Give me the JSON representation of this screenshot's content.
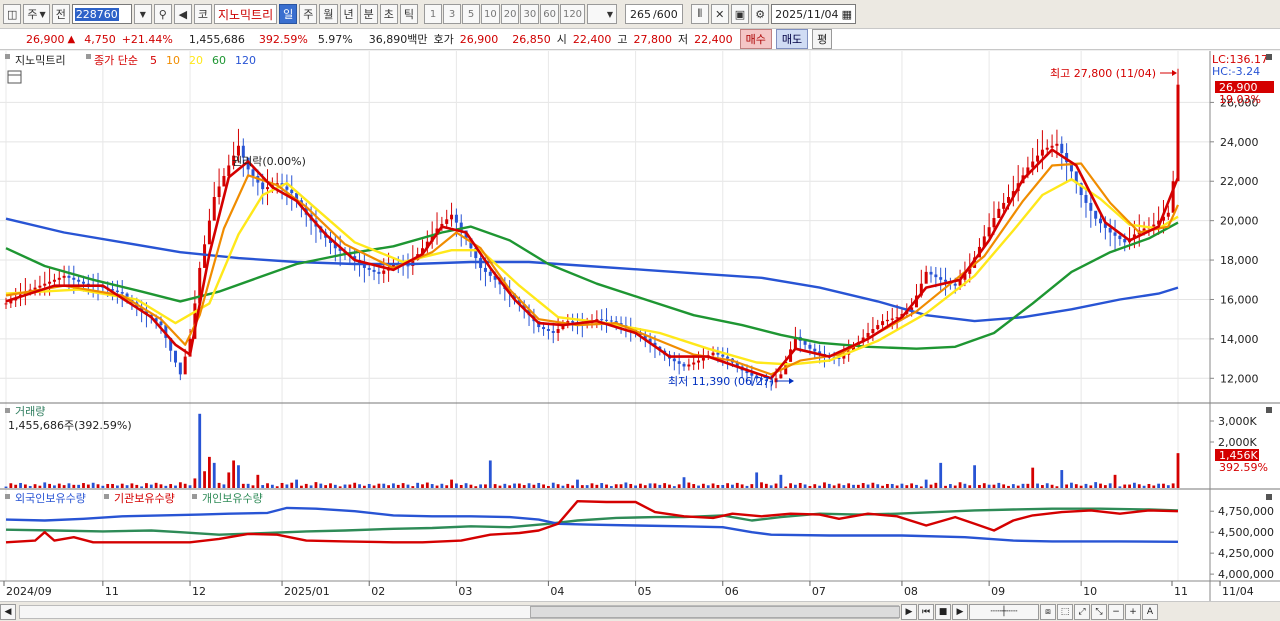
{
  "toolbar": {
    "market_btn": "주",
    "prev_btn": "전",
    "stock_code": "228760",
    "market_short": "코",
    "stock_name": "지노믹트리",
    "periods": [
      "일",
      "주",
      "월",
      "년",
      "분",
      "초",
      "틱"
    ],
    "active_period": "일",
    "intervals": [
      "1",
      "3",
      "5",
      "10",
      "20",
      "30",
      "60",
      "120"
    ],
    "count": "265",
    "count_total": "/600",
    "date": "2025/11/04"
  },
  "quote": {
    "price": "26,900",
    "change": "4,750",
    "change_pct": "+21.44%",
    "volume": "1,455,686",
    "volume_ratio": "392.59%",
    "turnover": "5.97%",
    "amount": "36,890백만",
    "ask_label": "호가",
    "ask1": "26,900",
    "ask2": "26,850",
    "open_label": "시",
    "open": "22,400",
    "high_label": "고",
    "high": "27,800",
    "low_label": "저",
    "low": "22,400",
    "buy_btn": "매수",
    "sell_btn": "매도",
    "eval_btn": "평"
  },
  "panels": {
    "price": {
      "legend_name": "지노믹트리",
      "legend_ma": "종가 단순",
      "ma_periods": [
        "5",
        "10",
        "20",
        "60",
        "120"
      ],
      "ma_colors": [
        "#d40000",
        "#f08c00",
        "#ffe81a",
        "#1e9632",
        "#2854d4"
      ],
      "lc": "LC:136.17",
      "hc": "HC:-3.24",
      "last_price_tag": "26,900",
      "last_pct_tag": "19.03%",
      "annotation_high": "최고 27,800 (11/04)",
      "annotation_low": "최저 11,390 (06/27)",
      "annotation_rights": "권리락(0.00%)",
      "y_ticks": [
        "26,000",
        "24,000",
        "22,000",
        "20,000",
        "18,000",
        "16,000",
        "14,000",
        "12,000"
      ]
    },
    "volume": {
      "title": "거래량",
      "current": "1,455,686주(392.59%)",
      "y_ticks": [
        "3,000K",
        "2,000K"
      ],
      "last_tag": "1,456K",
      "last_pct_tag": "392.59%"
    },
    "holdings": {
      "series_names": [
        "외국인보유수량",
        "기관보유수량",
        "개인보유수량"
      ],
      "colors": [
        "#2854d4",
        "#d40000",
        "#2e8b57"
      ],
      "y_ticks": [
        "4,750,000",
        "4,500,000",
        "4,250,000",
        "4,000,000"
      ]
    }
  },
  "x_axis": {
    "labels": [
      "2024/09",
      "11",
      "12",
      "2025/01",
      "02",
      "03",
      "04",
      "05",
      "06",
      "07",
      "08",
      "09",
      "10",
      "11",
      "11/04"
    ]
  },
  "chart_data": {
    "type": "line",
    "y_range": [
      11000,
      28000
    ],
    "close_series": [
      [
        0,
        15800
      ],
      [
        4,
        16400
      ],
      [
        8,
        16800
      ],
      [
        12,
        17200
      ],
      [
        16,
        16800
      ],
      [
        20,
        16600
      ],
      [
        24,
        16300
      ],
      [
        28,
        15400
      ],
      [
        32,
        14700
      ],
      [
        34,
        13400
      ],
      [
        36,
        12200
      ],
      [
        38,
        14000
      ],
      [
        40,
        17600
      ],
      [
        43,
        21200
      ],
      [
        46,
        22800
      ],
      [
        48,
        23800
      ],
      [
        50,
        22600
      ],
      [
        53,
        21600
      ],
      [
        56,
        21900
      ],
      [
        59,
        21400
      ],
      [
        62,
        20300
      ],
      [
        65,
        19400
      ],
      [
        68,
        18600
      ],
      [
        71,
        18200
      ],
      [
        74,
        17600
      ],
      [
        77,
        17300
      ],
      [
        80,
        17800
      ],
      [
        83,
        17700
      ],
      [
        86,
        18600
      ],
      [
        89,
        19600
      ],
      [
        92,
        20300
      ],
      [
        95,
        19100
      ],
      [
        98,
        17600
      ],
      [
        101,
        17000
      ],
      [
        104,
        16300
      ],
      [
        107,
        15500
      ],
      [
        110,
        14600
      ],
      [
        113,
        14300
      ],
      [
        116,
        14900
      ],
      [
        119,
        14700
      ],
      [
        122,
        15000
      ],
      [
        125,
        14900
      ],
      [
        128,
        14600
      ],
      [
        131,
        14200
      ],
      [
        134,
        13600
      ],
      [
        137,
        13000
      ],
      [
        140,
        12600
      ],
      [
        143,
        12900
      ],
      [
        146,
        13300
      ],
      [
        149,
        13000
      ],
      [
        152,
        12400
      ],
      [
        155,
        12000
      ],
      [
        158,
        11800
      ],
      [
        160,
        12200
      ],
      [
        163,
        14100
      ],
      [
        166,
        13500
      ],
      [
        169,
        13100
      ],
      [
        172,
        13000
      ],
      [
        175,
        13600
      ],
      [
        178,
        14300
      ],
      [
        181,
        14900
      ],
      [
        184,
        15100
      ],
      [
        187,
        15600
      ],
      [
        190,
        17400
      ],
      [
        193,
        17000
      ],
      [
        196,
        16700
      ],
      [
        199,
        17600
      ],
      [
        202,
        19200
      ],
      [
        205,
        20600
      ],
      [
        208,
        21500
      ],
      [
        211,
        22700
      ],
      [
        214,
        23600
      ],
      [
        217,
        23900
      ],
      [
        220,
        22500
      ],
      [
        222,
        21300
      ],
      [
        225,
        20100
      ],
      [
        228,
        19400
      ],
      [
        231,
        18900
      ],
      [
        234,
        19500
      ],
      [
        237,
        19800
      ],
      [
        240,
        20400
      ],
      [
        241,
        22000
      ],
      [
        242,
        26900
      ]
    ],
    "ma5": [
      [
        0,
        15900
      ],
      [
        10,
        16700
      ],
      [
        20,
        16700
      ],
      [
        30,
        15100
      ],
      [
        35,
        13700
      ],
      [
        38,
        13200
      ],
      [
        42,
        18300
      ],
      [
        46,
        22200
      ],
      [
        50,
        23000
      ],
      [
        55,
        21700
      ],
      [
        60,
        21000
      ],
      [
        66,
        19300
      ],
      [
        72,
        18000
      ],
      [
        80,
        17500
      ],
      [
        86,
        18300
      ],
      [
        90,
        19700
      ],
      [
        95,
        19400
      ],
      [
        100,
        17600
      ],
      [
        105,
        16000
      ],
      [
        110,
        14800
      ],
      [
        115,
        14700
      ],
      [
        122,
        14900
      ],
      [
        130,
        14300
      ],
      [
        137,
        13100
      ],
      [
        145,
        13100
      ],
      [
        152,
        12500
      ],
      [
        158,
        12000
      ],
      [
        163,
        13500
      ],
      [
        170,
        13100
      ],
      [
        178,
        14000
      ],
      [
        185,
        15100
      ],
      [
        190,
        16600
      ],
      [
        197,
        17000
      ],
      [
        203,
        19000
      ],
      [
        210,
        22100
      ],
      [
        216,
        23600
      ],
      [
        221,
        22800
      ],
      [
        227,
        19900
      ],
      [
        232,
        19000
      ],
      [
        238,
        19700
      ],
      [
        242,
        22200
      ]
    ],
    "ma10": [
      [
        0,
        16200
      ],
      [
        12,
        16700
      ],
      [
        24,
        16200
      ],
      [
        32,
        15000
      ],
      [
        37,
        13700
      ],
      [
        40,
        15200
      ],
      [
        45,
        19600
      ],
      [
        50,
        22300
      ],
      [
        56,
        21800
      ],
      [
        62,
        20700
      ],
      [
        70,
        18800
      ],
      [
        80,
        17600
      ],
      [
        88,
        18400
      ],
      [
        93,
        19400
      ],
      [
        98,
        18600
      ],
      [
        104,
        16500
      ],
      [
        110,
        15000
      ],
      [
        118,
        14700
      ],
      [
        126,
        14800
      ],
      [
        134,
        14000
      ],
      [
        142,
        13200
      ],
      [
        150,
        12900
      ],
      [
        158,
        12200
      ],
      [
        164,
        12900
      ],
      [
        172,
        13200
      ],
      [
        180,
        14300
      ],
      [
        188,
        15400
      ],
      [
        195,
        16800
      ],
      [
        202,
        18200
      ],
      [
        210,
        21000
      ],
      [
        216,
        22800
      ],
      [
        222,
        22900
      ],
      [
        228,
        20900
      ],
      [
        234,
        19400
      ],
      [
        240,
        19700
      ],
      [
        242,
        20800
      ]
    ],
    "ma20": [
      [
        0,
        16300
      ],
      [
        15,
        16500
      ],
      [
        27,
        16000
      ],
      [
        35,
        14800
      ],
      [
        42,
        15800
      ],
      [
        48,
        19300
      ],
      [
        53,
        21300
      ],
      [
        58,
        21900
      ],
      [
        65,
        20400
      ],
      [
        72,
        18900
      ],
      [
        82,
        17900
      ],
      [
        92,
        18500
      ],
      [
        98,
        18500
      ],
      [
        106,
        16700
      ],
      [
        114,
        15100
      ],
      [
        124,
        14800
      ],
      [
        135,
        14300
      ],
      [
        145,
        13500
      ],
      [
        155,
        12800
      ],
      [
        162,
        12700
      ],
      [
        170,
        12900
      ],
      [
        180,
        13900
      ],
      [
        190,
        15300
      ],
      [
        200,
        17200
      ],
      [
        208,
        19500
      ],
      [
        214,
        21300
      ],
      [
        220,
        22100
      ],
      [
        226,
        21100
      ],
      [
        232,
        19800
      ],
      [
        238,
        19600
      ],
      [
        242,
        20200
      ]
    ],
    "ma60": [
      [
        0,
        18600
      ],
      [
        8,
        17700
      ],
      [
        18,
        17000
      ],
      [
        28,
        16400
      ],
      [
        36,
        15900
      ],
      [
        44,
        16400
      ],
      [
        52,
        17100
      ],
      [
        60,
        17800
      ],
      [
        70,
        18300
      ],
      [
        80,
        18700
      ],
      [
        90,
        19400
      ],
      [
        96,
        19700
      ],
      [
        104,
        19000
      ],
      [
        112,
        17800
      ],
      [
        122,
        16800
      ],
      [
        132,
        16000
      ],
      [
        142,
        15200
      ],
      [
        152,
        14700
      ],
      [
        160,
        14200
      ],
      [
        168,
        13800
      ],
      [
        178,
        13600
      ],
      [
        188,
        13500
      ],
      [
        196,
        13600
      ],
      [
        204,
        14300
      ],
      [
        212,
        15800
      ],
      [
        220,
        17400
      ],
      [
        228,
        18400
      ],
      [
        236,
        19100
      ],
      [
        242,
        19900
      ]
    ],
    "ma120": [
      [
        0,
        20100
      ],
      [
        12,
        19400
      ],
      [
        24,
        18900
      ],
      [
        36,
        18400
      ],
      [
        48,
        18100
      ],
      [
        60,
        17900
      ],
      [
        72,
        17800
      ],
      [
        84,
        17800
      ],
      [
        96,
        17900
      ],
      [
        108,
        17900
      ],
      [
        120,
        17700
      ],
      [
        132,
        17500
      ],
      [
        144,
        17300
      ],
      [
        156,
        17100
      ],
      [
        168,
        16600
      ],
      [
        180,
        15900
      ],
      [
        190,
        15200
      ],
      [
        200,
        14900
      ],
      [
        210,
        15100
      ],
      [
        220,
        15500
      ],
      [
        230,
        16000
      ],
      [
        238,
        16300
      ],
      [
        242,
        16600
      ]
    ],
    "volume_highlights": [
      [
        39,
        400
      ],
      [
        40,
        3100
      ],
      [
        41,
        700
      ],
      [
        42,
        1300
      ],
      [
        43,
        1050
      ],
      [
        46,
        650
      ],
      [
        47,
        1150
      ],
      [
        48,
        950
      ],
      [
        52,
        550
      ],
      [
        60,
        350
      ],
      [
        92,
        350
      ],
      [
        100,
        1150
      ],
      [
        118,
        350
      ],
      [
        140,
        450
      ],
      [
        155,
        650
      ],
      [
        160,
        550
      ],
      [
        190,
        350
      ],
      [
        193,
        1050
      ],
      [
        200,
        950
      ],
      [
        212,
        850
      ],
      [
        218,
        750
      ],
      [
        229,
        550
      ],
      [
        242,
        1456
      ]
    ],
    "holdings_foreign": [
      [
        0,
        4650
      ],
      [
        8,
        4640
      ],
      [
        16,
        4660
      ],
      [
        24,
        4690
      ],
      [
        32,
        4700
      ],
      [
        40,
        4710
      ],
      [
        46,
        4720
      ],
      [
        54,
        4730
      ],
      [
        58,
        4790
      ],
      [
        64,
        4780
      ],
      [
        72,
        4750
      ],
      [
        80,
        4700
      ],
      [
        88,
        4690
      ],
      [
        96,
        4690
      ],
      [
        104,
        4680
      ],
      [
        110,
        4650
      ],
      [
        114,
        4600
      ],
      [
        120,
        4590
      ],
      [
        130,
        4580
      ],
      [
        140,
        4570
      ],
      [
        148,
        4560
      ],
      [
        154,
        4500
      ],
      [
        158,
        4470
      ],
      [
        170,
        4460
      ],
      [
        185,
        4460
      ],
      [
        198,
        4440
      ],
      [
        208,
        4400
      ],
      [
        216,
        4390
      ],
      [
        230,
        4390
      ],
      [
        242,
        4385
      ]
    ],
    "holdings_institution": [
      [
        0,
        4380
      ],
      [
        6,
        4400
      ],
      [
        8,
        4500
      ],
      [
        10,
        4400
      ],
      [
        14,
        4440
      ],
      [
        18,
        4380
      ],
      [
        30,
        4380
      ],
      [
        38,
        4380
      ],
      [
        44,
        4420
      ],
      [
        50,
        4480
      ],
      [
        56,
        4470
      ],
      [
        62,
        4400
      ],
      [
        70,
        4390
      ],
      [
        80,
        4380
      ],
      [
        86,
        4380
      ],
      [
        94,
        4400
      ],
      [
        100,
        4470
      ],
      [
        106,
        4490
      ],
      [
        110,
        4520
      ],
      [
        114,
        4600
      ],
      [
        118,
        4870
      ],
      [
        124,
        4860
      ],
      [
        130,
        4860
      ],
      [
        134,
        4740
      ],
      [
        140,
        4690
      ],
      [
        146,
        4670
      ],
      [
        150,
        4720
      ],
      [
        156,
        4690
      ],
      [
        162,
        4720
      ],
      [
        168,
        4710
      ],
      [
        172,
        4660
      ],
      [
        178,
        4720
      ],
      [
        184,
        4690
      ],
      [
        190,
        4580
      ],
      [
        196,
        4680
      ],
      [
        200,
        4600
      ],
      [
        204,
        4520
      ],
      [
        208,
        4640
      ],
      [
        212,
        4700
      ],
      [
        218,
        4740
      ],
      [
        224,
        4760
      ],
      [
        230,
        4720
      ],
      [
        236,
        4760
      ],
      [
        242,
        4750
      ]
    ],
    "holdings_individual": [
      [
        0,
        4530
      ],
      [
        10,
        4520
      ],
      [
        20,
        4510
      ],
      [
        30,
        4520
      ],
      [
        36,
        4500
      ],
      [
        44,
        4470
      ],
      [
        54,
        4490
      ],
      [
        62,
        4510
      ],
      [
        70,
        4520
      ],
      [
        80,
        4540
      ],
      [
        88,
        4550
      ],
      [
        96,
        4570
      ],
      [
        104,
        4560
      ],
      [
        112,
        4600
      ],
      [
        118,
        4640
      ],
      [
        126,
        4670
      ],
      [
        134,
        4680
      ],
      [
        140,
        4680
      ],
      [
        148,
        4700
      ],
      [
        154,
        4640
      ],
      [
        160,
        4680
      ],
      [
        168,
        4720
      ],
      [
        176,
        4710
      ],
      [
        184,
        4720
      ],
      [
        192,
        4740
      ],
      [
        200,
        4760
      ],
      [
        208,
        4770
      ],
      [
        216,
        4780
      ],
      [
        226,
        4780
      ],
      [
        236,
        4770
      ],
      [
        242,
        4760
      ]
    ]
  }
}
